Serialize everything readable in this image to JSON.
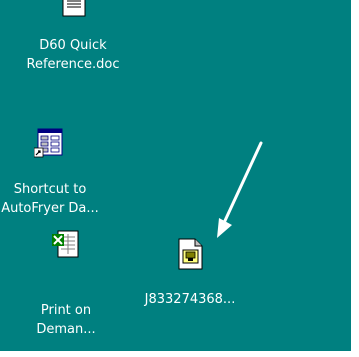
{
  "desktop": {
    "background": "#008080",
    "icons": [
      {
        "name": "d60-quick-reference",
        "icon": "word-document-icon",
        "lines": [
          "D60 Quick",
          "Reference.doc"
        ]
      },
      {
        "name": "shortcut-autofryer",
        "icon": "database-shortcut-icon",
        "lines": [
          "Shortcut to",
          "AutoFryer Da..."
        ]
      },
      {
        "name": "print-on-demand",
        "icon": "excel-document-icon",
        "lines": [
          "Print on",
          "Deman..."
        ]
      },
      {
        "name": "j833274368",
        "icon": "generic-document-icon",
        "lines": [
          "J833274368..."
        ]
      }
    ]
  },
  "annotation": {
    "arrow_color": "#ffffff",
    "icon": "pointer-arrow-icon"
  }
}
